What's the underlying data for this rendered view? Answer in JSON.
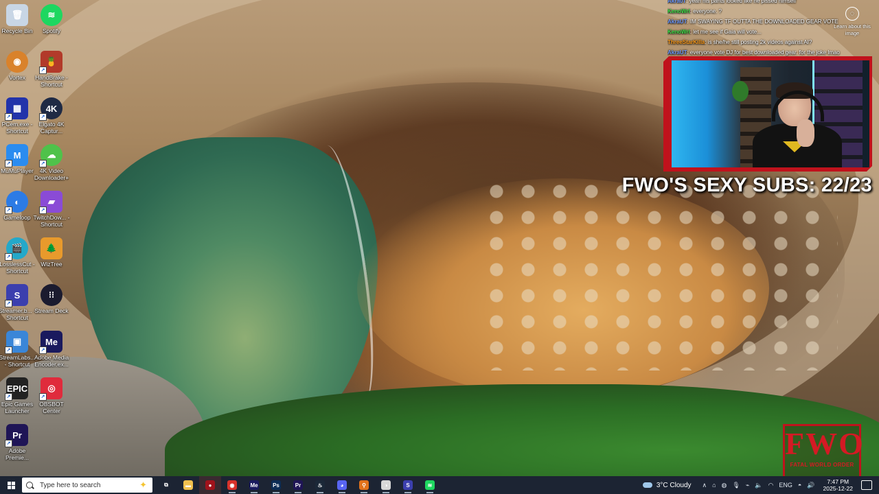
{
  "desktop_icons": [
    {
      "label": "Recycle Bin",
      "icon": "recycle-bin-icon",
      "color": "#c8d6e5",
      "glyph": "🗑",
      "shortcut": false
    },
    {
      "label": "Spotify",
      "icon": "spotify-icon",
      "color": "#1ed760",
      "glyph": "≋",
      "shortcut": false,
      "round": true
    },
    {
      "label": "Vortex",
      "icon": "vortex-icon",
      "color": "#d9822b",
      "glyph": "◉",
      "shortcut": false,
      "round": true
    },
    {
      "label": "HandBrake - Shortcut",
      "icon": "handbrake-icon",
      "color": "#b23a2a",
      "glyph": "🍍",
      "shortcut": true
    },
    {
      "label": "PCem.exe - Shortcut",
      "icon": "pcem-icon",
      "color": "#2233aa",
      "glyph": "▦",
      "shortcut": true
    },
    {
      "label": "Elgato 4K Captur...",
      "icon": "elgato-4k-icon",
      "color": "#1f2a44",
      "glyph": "4K",
      "shortcut": true,
      "round": true
    },
    {
      "label": "MuMuPlayer",
      "icon": "mumuplayer-icon",
      "color": "#2a8cf0",
      "glyph": "M",
      "shortcut": true
    },
    {
      "label": "4K Video Downloader+",
      "icon": "4k-video-downloader-icon",
      "color": "#4fc24a",
      "glyph": "☁",
      "shortcut": true,
      "round": true
    },
    {
      "label": "Gameloop",
      "icon": "gameloop-icon",
      "color": "#2c7be5",
      "glyph": "◐",
      "shortcut": true,
      "round": true
    },
    {
      "label": "TwitchDow... - Shortcut",
      "icon": "twitch-downloader-icon",
      "color": "#8a4bd6",
      "glyph": "▰",
      "shortcut": true
    },
    {
      "label": "LosslessCut - Shortcut",
      "icon": "losslesscut-icon",
      "color": "#24a8c9",
      "glyph": "🎬",
      "shortcut": true,
      "round": true
    },
    {
      "label": "WizTree",
      "icon": "wiztree-icon",
      "color": "#e89a2c",
      "glyph": "🌲",
      "shortcut": false
    },
    {
      "label": "Streamer.b... - Shortcut",
      "icon": "streamerbot-icon",
      "color": "#3b3fae",
      "glyph": "S",
      "shortcut": true
    },
    {
      "label": "Stream Deck",
      "icon": "stream-deck-icon",
      "color": "#1b1b2f",
      "glyph": "⁝⁝",
      "shortcut": false,
      "round": true
    },
    {
      "label": "StreamLabs... - Shortcut",
      "icon": "streamlabs-icon",
      "color": "#3a86d8",
      "glyph": "▣",
      "shortcut": true
    },
    {
      "label": "Adobe Media Encoder.ex...",
      "icon": "adobe-media-encoder-icon",
      "color": "#1a1a5e",
      "glyph": "Me",
      "shortcut": true
    },
    {
      "label": "Epic Games Launcher",
      "icon": "epic-games-icon",
      "color": "#222222",
      "glyph": "EPIC",
      "shortcut": true
    },
    {
      "label": "OBSBOT Center",
      "icon": "obsbot-icon",
      "color": "#e02b3c",
      "glyph": "◎",
      "shortcut": true
    },
    {
      "label": "Adobe Premie...",
      "icon": "adobe-premiere-icon",
      "color": "#1f1556",
      "glyph": "Pr",
      "shortcut": true
    }
  ],
  "chat": [
    {
      "name": "Akra0T",
      "name_color": "#6f9bff",
      "message": "yeah his pants looked like he pissed himself"
    },
    {
      "name": "KenoWrl",
      "name_color": "#3fe34a",
      "message": "everyone. ?"
    },
    {
      "name": "AkraUT",
      "name_color": "#6f9bff",
      "message": "IM SWAYING TF OUTTA THE DOWNLOADED GEAR VOTE"
    },
    {
      "name": "KenoWrl",
      "name_color": "#3fe34a",
      "message": "let me see if Gaia will vote..."
    },
    {
      "name": "ThreeStarKilla",
      "name_color": "#ff9d1c",
      "message": "is she/he still posting 2k videos against AI?"
    },
    {
      "name": "AkraUT",
      "name_color": "#6f9bff",
      "message": "everyone vote DJ for best downloaded gear. for the joke lmao"
    }
  ],
  "learn_about": "Learn about this image",
  "subs_text": "FWO'S SEXY SUBS: 22/23",
  "fwo_logo": {
    "big": "FWO",
    "small": "FATAL WORLD ORDER"
  },
  "taskbar": {
    "search_placeholder": "Type here to search",
    "apps": [
      {
        "icon": "task-view-icon",
        "glyph": "⧉",
        "color": "transparent"
      },
      {
        "icon": "file-explorer-icon",
        "glyph": "▬",
        "color": "#f2c14e"
      },
      {
        "icon": "obs-studio-icon",
        "glyph": "●",
        "color": "#a0131c",
        "active": true
      },
      {
        "icon": "chrome-icon",
        "glyph": "◉",
        "color": "#d8322b",
        "running": true
      },
      {
        "icon": "media-encoder-taskbar-icon",
        "glyph": "Me",
        "color": "#1a1a5e",
        "running": true
      },
      {
        "icon": "photoshop-icon",
        "glyph": "Ps",
        "color": "#0c2d55",
        "running": true
      },
      {
        "icon": "premiere-taskbar-icon",
        "glyph": "Pr",
        "color": "#1f1556",
        "running": true
      },
      {
        "icon": "steam-icon",
        "glyph": "♨",
        "color": "#1b2838",
        "running": true
      },
      {
        "icon": "discord-icon",
        "glyph": "◕",
        "color": "#5865f2",
        "running": true
      },
      {
        "icon": "search-app-icon",
        "glyph": "⚲",
        "color": "#e0721b",
        "running": true
      },
      {
        "icon": "vivaldi-icon",
        "glyph": "◑",
        "color": "#d8d8d8",
        "running": true
      },
      {
        "icon": "streamerbot-taskbar-icon",
        "glyph": "S",
        "color": "#3b3fae",
        "running": true
      },
      {
        "icon": "spotify-taskbar-icon",
        "glyph": "≋",
        "color": "#1ed760",
        "running": true
      }
    ],
    "weather": "3°C  Cloudy",
    "language": "ENG",
    "time": "7:47 PM",
    "date": "2025-12-22"
  }
}
